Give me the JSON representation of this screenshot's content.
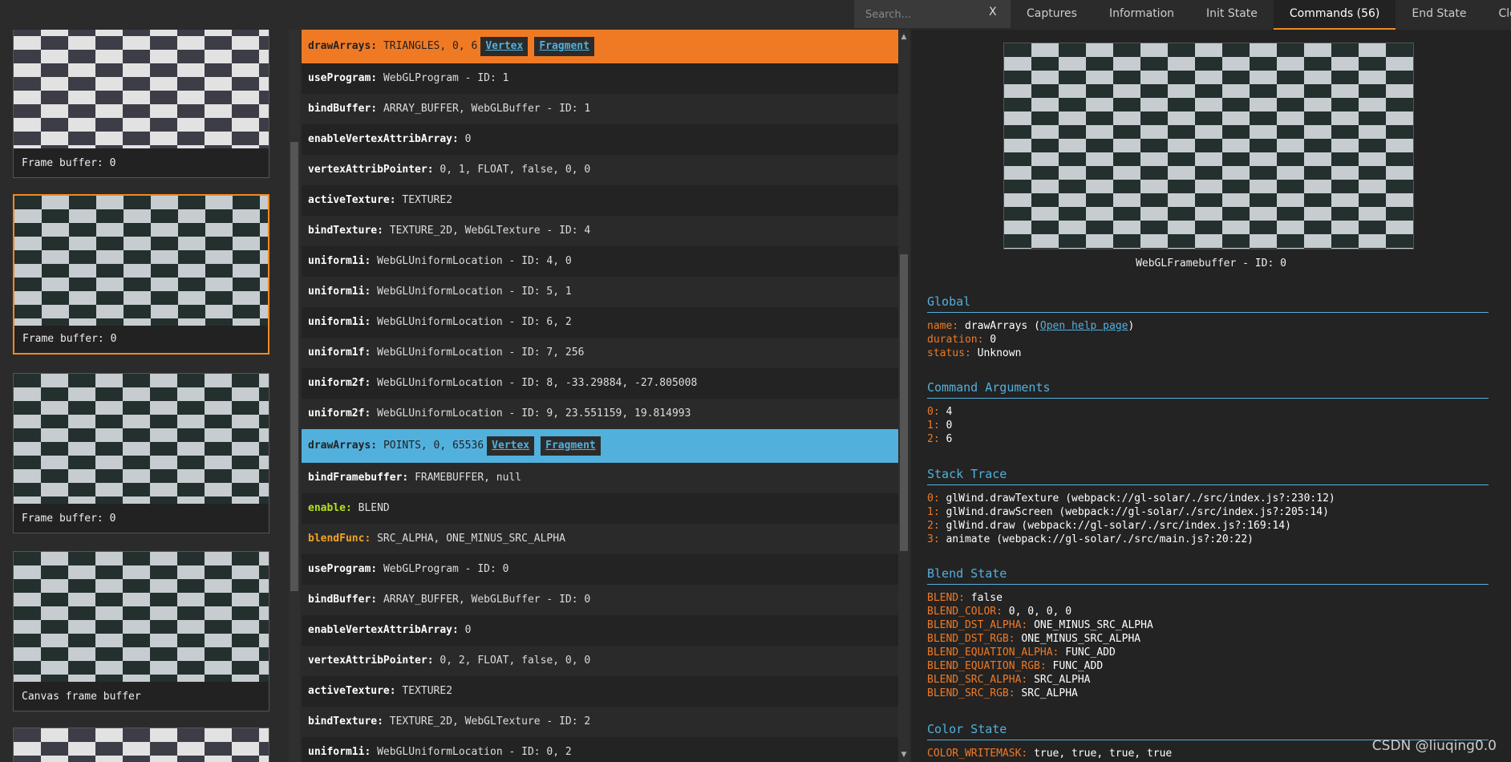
{
  "search": {
    "placeholder": "Search...",
    "clear": "X"
  },
  "tabs": [
    {
      "label": "Captures"
    },
    {
      "label": "Information"
    },
    {
      "label": "Init State"
    },
    {
      "label": "Commands (56)"
    },
    {
      "label": "End State"
    },
    {
      "label": "Close"
    }
  ],
  "active_tab": 3,
  "thumbnails": [
    {
      "caption": "Frame buffer: 0"
    },
    {
      "caption": "Frame buffer: 0"
    },
    {
      "caption": "Frame buffer: 0"
    },
    {
      "caption": "Canvas frame buffer"
    }
  ],
  "commands": [
    {
      "name": "drawArrays",
      "args": "TRIANGLES, 0, 6",
      "vertex": "Vertex",
      "fragment": "Fragment"
    },
    {
      "name": "useProgram",
      "args": "WebGLProgram - ID: 1"
    },
    {
      "name": "bindBuffer",
      "args": "ARRAY_BUFFER, WebGLBuffer - ID: 1"
    },
    {
      "name": "enableVertexAttribArray",
      "args": "0"
    },
    {
      "name": "vertexAttribPointer",
      "args": "0, 1, FLOAT, false, 0, 0"
    },
    {
      "name": "activeTexture",
      "args": "TEXTURE2"
    },
    {
      "name": "bindTexture",
      "args": "TEXTURE_2D, WebGLTexture - ID: 4"
    },
    {
      "name": "uniform1i",
      "args": "WebGLUniformLocation - ID: 4, 0"
    },
    {
      "name": "uniform1i",
      "args": "WebGLUniformLocation - ID: 5, 1"
    },
    {
      "name": "uniform1i",
      "args": "WebGLUniformLocation - ID: 6, 2"
    },
    {
      "name": "uniform1f",
      "args": "WebGLUniformLocation - ID: 7, 256"
    },
    {
      "name": "uniform2f",
      "args": "WebGLUniformLocation - ID: 8, -33.29884, -27.805008"
    },
    {
      "name": "uniform2f",
      "args": "WebGLUniformLocation - ID: 9, 23.551159, 19.814993"
    },
    {
      "name": "drawArrays",
      "args": "POINTS, 0, 65536",
      "vertex": "Vertex",
      "fragment": "Fragment"
    },
    {
      "name": "bindFramebuffer",
      "args": "FRAMEBUFFER, null"
    },
    {
      "name": "enable",
      "args": "BLEND"
    },
    {
      "name": "blendFunc",
      "args": "SRC_ALPHA, ONE_MINUS_SRC_ALPHA"
    },
    {
      "name": "useProgram",
      "args": "WebGLProgram - ID: 0"
    },
    {
      "name": "bindBuffer",
      "args": "ARRAY_BUFFER, WebGLBuffer - ID: 0"
    },
    {
      "name": "enableVertexAttribArray",
      "args": "0"
    },
    {
      "name": "vertexAttribPointer",
      "args": "0, 2, FLOAT, false, 0, 0"
    },
    {
      "name": "activeTexture",
      "args": "TEXTURE2"
    },
    {
      "name": "bindTexture",
      "args": "TEXTURE_2D, WebGLTexture - ID: 2"
    },
    {
      "name": "uniform1i",
      "args": "WebGLUniformLocation - ID: 0, 2"
    }
  ],
  "details": {
    "framebuffer_label": "WebGLFramebuffer - ID: 0",
    "global": {
      "title": "Global",
      "name_key": "name:",
      "name_val": "drawArrays",
      "help_link": "Open help page",
      "duration_key": "duration:",
      "duration_val": "0",
      "status_key": "status:",
      "status_val": "Unknown"
    },
    "args": {
      "title": "Command Arguments",
      "items": [
        {
          "k": "0:",
          "v": "4"
        },
        {
          "k": "1:",
          "v": "0"
        },
        {
          "k": "2:",
          "v": "6"
        }
      ]
    },
    "stack": {
      "title": "Stack Trace",
      "items": [
        {
          "k": "0:",
          "v": "glWind.drawTexture (webpack://gl-solar/./src/index.js?:230:12)"
        },
        {
          "k": "1:",
          "v": "glWind.drawScreen (webpack://gl-solar/./src/index.js?:205:14)"
        },
        {
          "k": "2:",
          "v": "glWind.draw (webpack://gl-solar/./src/index.js?:169:14)"
        },
        {
          "k": "3:",
          "v": "animate (webpack://gl-solar/./src/main.js?:20:22)"
        }
      ]
    },
    "blend": {
      "title": "Blend State",
      "items": [
        {
          "k": "BLEND:",
          "v": "false"
        },
        {
          "k": "BLEND_COLOR:",
          "v": "0, 0, 0, 0"
        },
        {
          "k": "BLEND_DST_ALPHA:",
          "v": "ONE_MINUS_SRC_ALPHA"
        },
        {
          "k": "BLEND_DST_RGB:",
          "v": "ONE_MINUS_SRC_ALPHA"
        },
        {
          "k": "BLEND_EQUATION_ALPHA:",
          "v": "FUNC_ADD"
        },
        {
          "k": "BLEND_EQUATION_RGB:",
          "v": "FUNC_ADD"
        },
        {
          "k": "BLEND_SRC_ALPHA:",
          "v": "SRC_ALPHA"
        },
        {
          "k": "BLEND_SRC_RGB:",
          "v": "SRC_ALPHA"
        }
      ]
    },
    "color": {
      "title": "Color State",
      "items": [
        {
          "k": "COLOR_WRITEMASK:",
          "v": "true, true, true, true"
        }
      ]
    }
  },
  "watermark": "CSDN @liuqing0.0",
  "colors": {
    "accent": "#f07a24",
    "selected_blue": "#52b0dd",
    "enable_green": "#b2e31c"
  }
}
